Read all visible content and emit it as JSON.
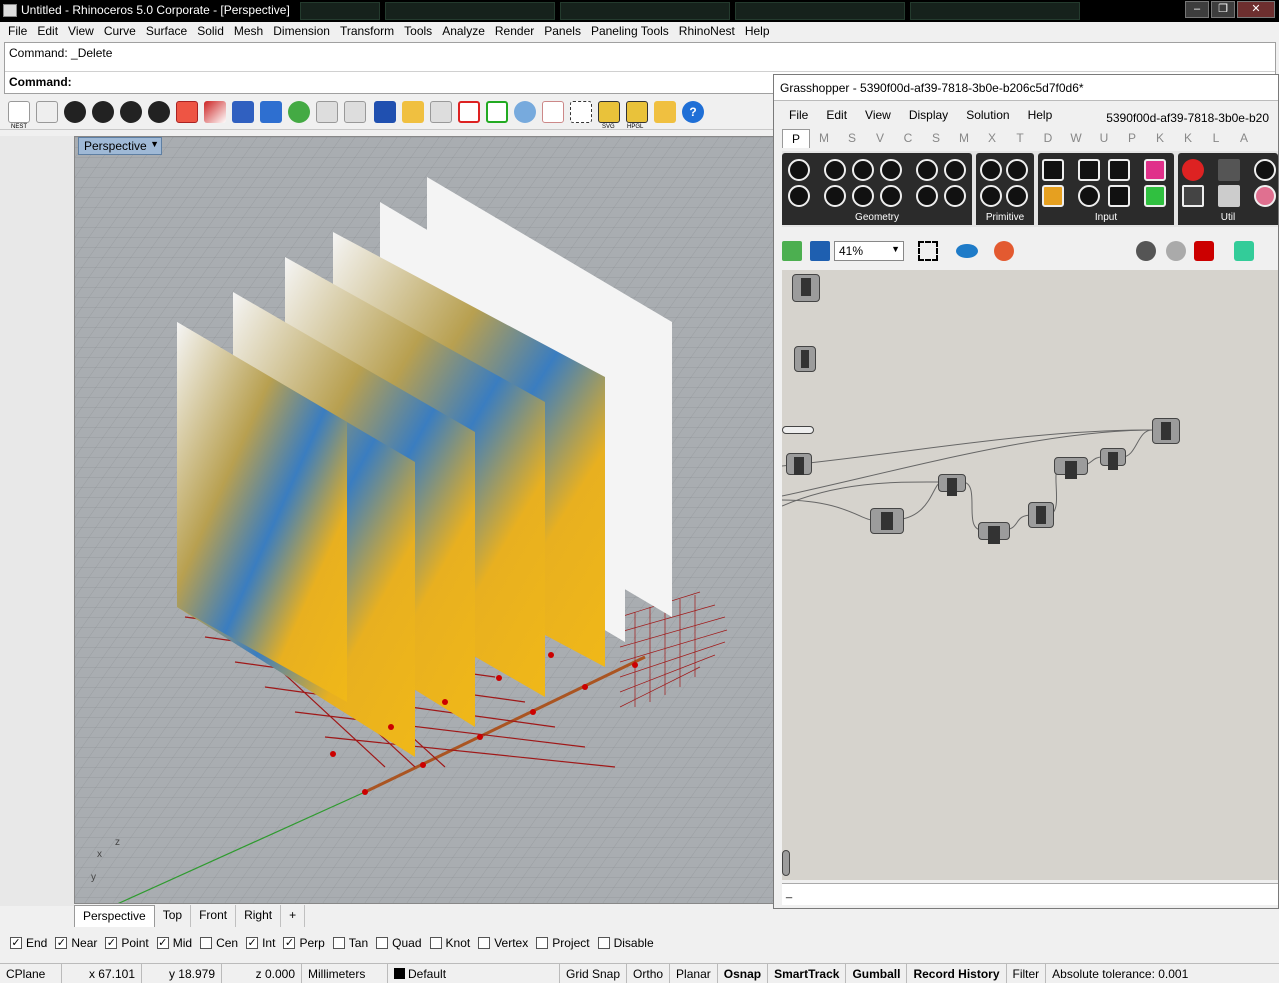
{
  "window": {
    "title": "Untitled - Rhinoceros  5.0 Corporate - [Perspective]",
    "buttons": {
      "minimize": "–",
      "restore": "❐",
      "close": "✕"
    }
  },
  "menu": [
    "File",
    "Edit",
    "View",
    "Curve",
    "Surface",
    "Solid",
    "Mesh",
    "Dimension",
    "Transform",
    "Tools",
    "Analyze",
    "Render",
    "Panels",
    "Paneling Tools",
    "RhinoNest",
    "Help"
  ],
  "command": {
    "history": "Command: _Delete",
    "prompt": "Command:"
  },
  "toolbar": {
    "nest_label": "NEST",
    "svg_label": "SVG",
    "hpgl_label": "HPGL"
  },
  "viewport": {
    "name": "Perspective",
    "axes": {
      "x": "x",
      "y": "y",
      "z": "z"
    }
  },
  "viewport_tabs": [
    "Perspective",
    "Top",
    "Front",
    "Right",
    "+"
  ],
  "osnaps": [
    {
      "label": "End",
      "checked": true
    },
    {
      "label": "Near",
      "checked": true
    },
    {
      "label": "Point",
      "checked": true
    },
    {
      "label": "Mid",
      "checked": true
    },
    {
      "label": "Cen",
      "checked": false
    },
    {
      "label": "Int",
      "checked": true
    },
    {
      "label": "Perp",
      "checked": true
    },
    {
      "label": "Tan",
      "checked": false
    },
    {
      "label": "Quad",
      "checked": false
    },
    {
      "label": "Knot",
      "checked": false
    },
    {
      "label": "Vertex",
      "checked": false
    },
    {
      "label": "Project",
      "checked": false
    },
    {
      "label": "Disable",
      "checked": false
    }
  ],
  "status": {
    "cplane": "CPlane",
    "x": "x 67.101",
    "y": "y 18.979",
    "z": "z 0.000",
    "units": "Millimeters",
    "layer": "Default",
    "grid_snap": "Grid Snap",
    "ortho": "Ortho",
    "planar": "Planar",
    "osnap": "Osnap",
    "smarttrack": "SmartTrack",
    "gumball": "Gumball",
    "record_history": "Record History",
    "filter": "Filter",
    "tolerance": "Absolute tolerance: 0.001"
  },
  "grasshopper": {
    "title": "Grasshopper - 5390f00d-af39-7818-3b0e-b206c5d7f0d6*",
    "doc_id": "5390f00d-af39-7818-3b0e-b20",
    "menu": [
      "File",
      "Edit",
      "View",
      "Display",
      "Solution",
      "Help"
    ],
    "tabs": [
      "P",
      "M",
      "S",
      "V",
      "C",
      "S",
      "M",
      "X",
      "T",
      "D",
      "W",
      "U",
      "P",
      "K",
      "K",
      "L",
      "A"
    ],
    "groups": [
      "Geometry",
      "Primitive",
      "Input",
      "Util"
    ],
    "zoom": "41%",
    "status": "_"
  },
  "colors": {
    "accent": "#9fb9d6",
    "viewport_bg": "#a8acb0",
    "grid": "#6f7275",
    "red_grid": "#a01818"
  }
}
